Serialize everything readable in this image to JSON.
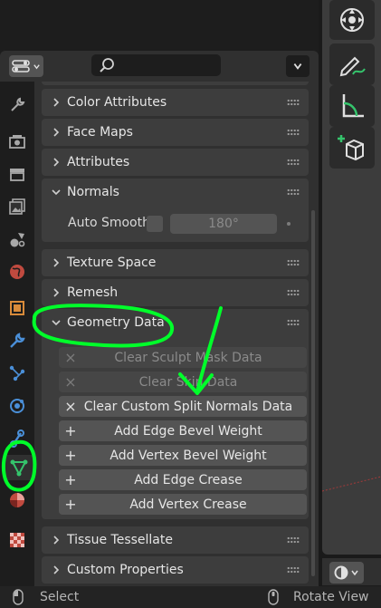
{
  "header": {
    "editor_type_icon": "properties-editor-icon",
    "search_placeholder": "",
    "options_icon": "chevron-down-icon"
  },
  "tabs": [
    {
      "icon": "tool-icon",
      "color": "#9a9a9a"
    },
    {
      "icon": "render-icon",
      "color": "#9a9a9a"
    },
    {
      "icon": "output-icon",
      "color": "#9a9a9a"
    },
    {
      "icon": "view-layer-icon",
      "color": "#9a9a9a"
    },
    {
      "icon": "scene-icon",
      "color": "#9a9a9a"
    },
    {
      "icon": "world-icon",
      "color": "#c04a3f"
    },
    {
      "icon": "object-icon",
      "color": "#d98b3a"
    },
    {
      "icon": "modifier-icon",
      "color": "#4a8fd8"
    },
    {
      "icon": "particles-icon",
      "color": "#4a8fd8"
    },
    {
      "icon": "physics-icon",
      "color": "#4a8fd8"
    },
    {
      "icon": "constraints-icon",
      "color": "#4a8fd8"
    },
    {
      "icon": "data-icon",
      "color": "#35c46c"
    },
    {
      "icon": "material-icon",
      "color": "#c04a3f"
    },
    {
      "icon": "texture-icon",
      "color": "#c04a3f"
    }
  ],
  "sections": {
    "color_attributes": "Color Attributes",
    "face_maps": "Face Maps",
    "attributes": "Attributes",
    "normals": "Normals",
    "texture_space": "Texture Space",
    "remesh": "Remesh",
    "geometry_data": "Geometry Data",
    "tissue_tessellate": "Tissue Tessellate",
    "custom_properties": "Custom Properties"
  },
  "normals": {
    "auto_smooth_label": "Auto Smooth",
    "auto_smooth_checked": false,
    "angle_value": "180°"
  },
  "geometry_ops": [
    {
      "prefix": "×",
      "label": "Clear Sculpt Mask Data",
      "enabled": false
    },
    {
      "prefix": "×",
      "label": "Clear Skin Data",
      "enabled": false
    },
    {
      "prefix": "×",
      "label": "Clear Custom Split Normals Data",
      "enabled": true
    },
    {
      "prefix": "+",
      "label": "Add Edge Bevel Weight",
      "enabled": true
    },
    {
      "prefix": "+",
      "label": "Add Vertex Bevel Weight",
      "enabled": true
    },
    {
      "prefix": "+",
      "label": "Add Edge Crease",
      "enabled": true
    },
    {
      "prefix": "+",
      "label": "Add Vertex Crease",
      "enabled": true
    }
  ],
  "viewport_tools": [
    {
      "icon": "move-gizmo-icon"
    },
    {
      "icon": "annotate-icon"
    },
    {
      "icon": "measure-icon"
    },
    {
      "icon": "add-cube-icon"
    }
  ],
  "status_bar": {
    "select": "Select",
    "rotate_view": "Rotate View"
  },
  "colors": {
    "annotation_green": "#00ff2a",
    "accent_blue": "#4a8fd8",
    "data_green": "#35c46c"
  }
}
